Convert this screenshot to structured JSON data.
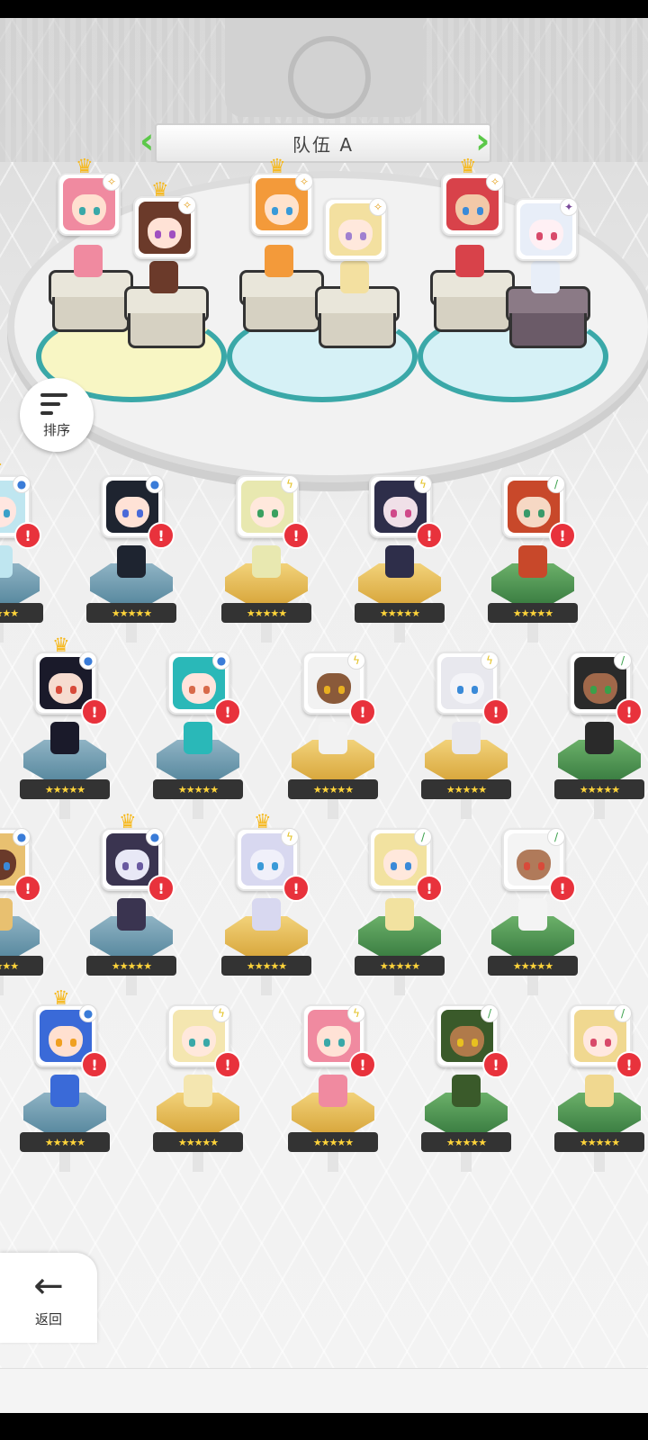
{
  "team": {
    "title": "队伍 A"
  },
  "controls": {
    "sort_label": "排序",
    "back_label": "返回"
  },
  "team_slots": [
    {
      "element": "star",
      "crown": true,
      "hair": "#f08aa0",
      "skin": "#ffe0d0",
      "eye": "#3aa8a8"
    },
    {
      "element": "star",
      "crown": true,
      "hair": "#6b3a2a",
      "skin": "#ffe2d6",
      "eye": "#a050c0"
    },
    {
      "element": "star",
      "crown": true,
      "hair": "#f39a3a",
      "skin": "#ffe2cc",
      "eye": "#3a9ad8"
    },
    {
      "element": "star",
      "crown": false,
      "hair": "#f3e0a0",
      "skin": "#ffe8dc",
      "eye": "#a080d0"
    },
    {
      "element": "star",
      "crown": true,
      "hair": "#d8424a",
      "skin": "#f2c9a8",
      "eye": "#3a8ad8"
    },
    {
      "element": "dark",
      "crown": false,
      "hair": "#e8eef8",
      "skin": "#fff0f4",
      "eye": "#d84a6a"
    }
  ],
  "roster": [
    {
      "element": "water",
      "crown": true,
      "pedestal": "blue",
      "hair": "#bfe6f0",
      "skin": "#ffe6e0",
      "eye": "#3aa0c8"
    },
    {
      "element": "water",
      "crown": false,
      "pedestal": "blue",
      "hair": "#1e2430",
      "skin": "#ffe2d6",
      "eye": "#4a6ad8"
    },
    {
      "element": "light",
      "crown": false,
      "pedestal": "yellow",
      "hair": "#e8e8b0",
      "skin": "#ffe8dc",
      "eye": "#3aa060"
    },
    {
      "element": "light",
      "crown": false,
      "pedestal": "yellow",
      "hair": "#2e2e4a",
      "skin": "#f0e0e8",
      "eye": "#d04a8a"
    },
    {
      "element": "grass",
      "crown": false,
      "pedestal": "green",
      "hair": "#c8482a",
      "skin": "#f6d8c4",
      "eye": "#3a9a6a"
    },
    {
      "element": "water",
      "crown": true,
      "pedestal": "blue",
      "hair": "#1a1a2a",
      "skin": "#f6dcd0",
      "eye": "#d84a3a"
    },
    {
      "element": "water",
      "crown": false,
      "pedestal": "blue",
      "hair": "#2ab8b8",
      "skin": "#ffe4dc",
      "eye": "#d86a4a"
    },
    {
      "element": "light",
      "crown": false,
      "pedestal": "yellow",
      "hair": "#f2f2f2",
      "skin": "#8a5a3a",
      "eye": "#e8b020"
    },
    {
      "element": "light",
      "crown": false,
      "pedestal": "yellow",
      "hair": "#e8e8ee",
      "skin": "#f4f4f8",
      "eye": "#3a8ad8"
    },
    {
      "element": "grass",
      "crown": false,
      "pedestal": "green",
      "hair": "#2a2a2a",
      "skin": "#a0684a",
      "eye": "#3aa04a"
    },
    {
      "element": "water",
      "crown": false,
      "pedestal": "blue",
      "hair": "#e8c070",
      "skin": "#6a3a2a",
      "eye": "#3a8ad8"
    },
    {
      "element": "water",
      "crown": true,
      "pedestal": "blue",
      "hair": "#3a3450",
      "skin": "#e8e8f6",
      "eye": "#6a5aa0"
    },
    {
      "element": "light",
      "crown": true,
      "pedestal": "yellow",
      "hair": "#d8d8f0",
      "skin": "#f0f0fa",
      "eye": "#3a9ad8"
    },
    {
      "element": "grass",
      "crown": false,
      "pedestal": "green",
      "hair": "#f2e2a0",
      "skin": "#ffe8dc",
      "eye": "#3a8ad8"
    },
    {
      "element": "grass",
      "crown": false,
      "pedestal": "green",
      "hair": "#f4f4f4",
      "skin": "#b07a5a",
      "eye": "#d84a3a"
    },
    {
      "element": "water",
      "crown": true,
      "pedestal": "blue",
      "hair": "#3a6ad8",
      "skin": "#ffe0d0",
      "eye": "#f0a020"
    },
    {
      "element": "light",
      "crown": false,
      "pedestal": "yellow",
      "hair": "#f4e6b0",
      "skin": "#ffe8dc",
      "eye": "#3aa8a8"
    },
    {
      "element": "light",
      "crown": false,
      "pedestal": "yellow",
      "hair": "#f08aa0",
      "skin": "#ffe2d6",
      "eye": "#3aa8a8"
    },
    {
      "element": "grass",
      "crown": false,
      "pedestal": "green",
      "hair": "#3a5a2a",
      "skin": "#b07a4a",
      "eye": "#e8c020"
    },
    {
      "element": "grass",
      "crown": false,
      "pedestal": "green",
      "hair": "#f0d890",
      "skin": "#ffe8e0",
      "eye": "#d84a6a"
    }
  ],
  "icons": {
    "sort": "sort-icon",
    "back": "back-arrow-icon",
    "alert": "!",
    "stars": "★★★★★"
  }
}
